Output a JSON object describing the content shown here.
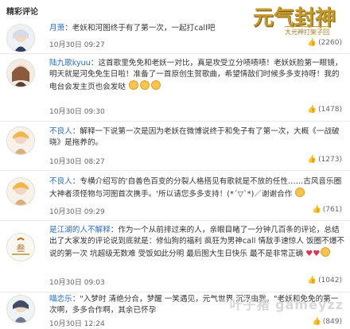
{
  "header": {
    "title": "精彩评论",
    "logo_main": "元气封神",
    "logo_sub": "大元神打架子回"
  },
  "comments": [
    {
      "user": "月萧",
      "text": "老妖和河图终于有了第一次，一起打call吧",
      "time": "10月30日 09:27",
      "likes": "(2260)"
    },
    {
      "user": "陆九歌kyuu",
      "text": "这首歌里免免和老妖一对比，真是攻受立分啧啧啧！老妖妖脸第一眼镜，明天就是河免免生日啦！准备了一首原创生贺歌曲，希望情敌们时候多多支持呀！我的电台会发主页也会发哒",
      "time": "10月30日 09:30",
      "likes": "(1478)"
    },
    {
      "user": "不良人",
      "text": "解释一下说第一次是因为老妖在微博说终于和免子有了第一次，大概《一战破晓》是拖养的。",
      "time": "10月30日 08:27",
      "likes": "(1273)"
    },
    {
      "user": "不良人",
      "text": "专横介绍写的'自善色百变的分裂人格搭见有歌就是不放的任性……古风音乐圈大神者须怪物与河图首次携手。'所以请您多多支持！(*´▽`*)／谢谢合作",
      "time": "10月30日 09:29",
      "likes": "(761)"
    },
    {
      "user": "是江湖的人不解释",
      "text": "作为一个从前排过来的人，亲眼目睹了一分钟几百条的评论，总结出了大家发的评论说到底就是：修仙狗的福利 疯狂为男神call 情敌手速惊人 饭圈不爆不说的第一次 坑超级无数难 受饭如此分明 最后图大生日快乐 最不是非常正确",
      "time": "10月30日 09:03",
      "likes": "(1042)"
    },
    {
      "user": "喵恋乐",
      "text": "\"入梦时 清绝分合，梦醒 一笑遇见，元气世界 沉浮由我。\"老妖和免免的第一次啊，多多合作啊，其余已怀孕",
      "time": "10月30日 12:24",
      "likes": "(849)"
    }
  ],
  "watermark": "叶子猪 gameyzz"
}
